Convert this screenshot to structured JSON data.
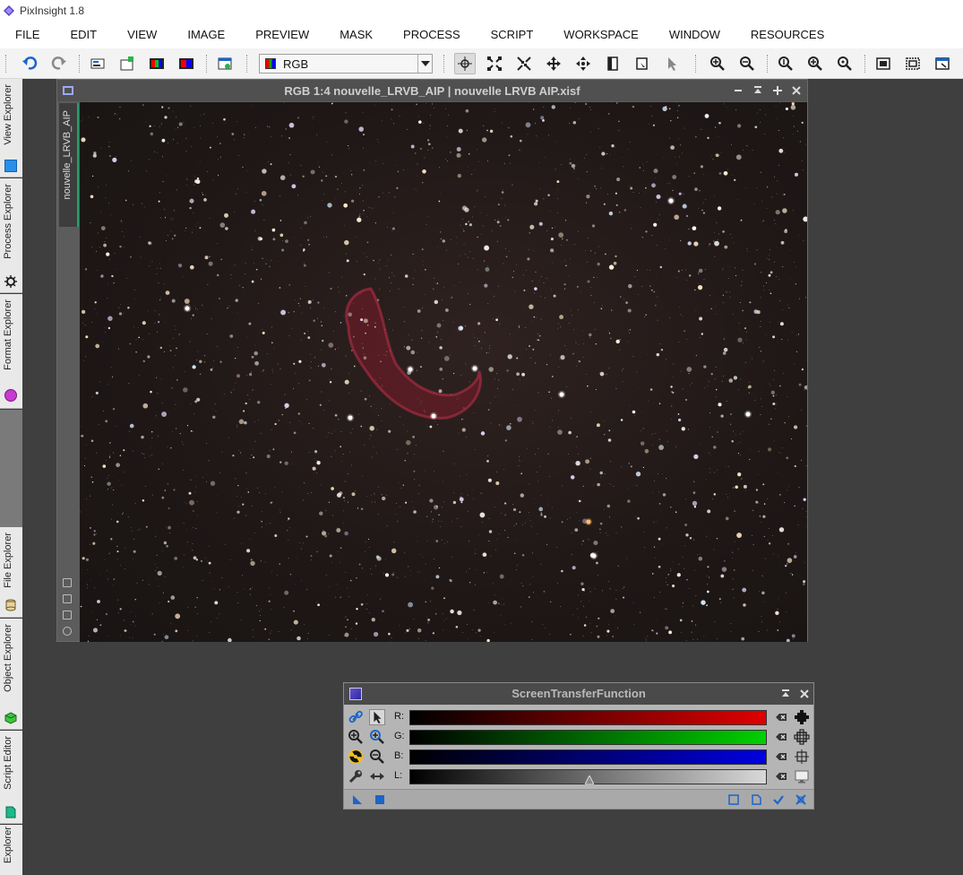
{
  "window": {
    "title": "PixInsight 1.8"
  },
  "menu": [
    "FILE",
    "EDIT",
    "VIEW",
    "IMAGE",
    "PREVIEW",
    "MASK",
    "PROCESS",
    "SCRIPT",
    "WORKSPACE",
    "WINDOW",
    "RESOURCES"
  ],
  "toolbar": {
    "channel_select_value": "RGB"
  },
  "left_dock": {
    "tabs": [
      "View Explorer",
      "Process Explorer",
      "Format Explorer",
      "File Explorer",
      "Object Explorer",
      "Script Editor",
      "Explorer"
    ]
  },
  "image_window": {
    "title": "RGB 1:4 nouvelle_LRVB_AIP | nouvelle LRVB AIP.xisf",
    "view_tab": "nouvelle_LRVB_AIP"
  },
  "stf_panel": {
    "title": "ScreenTransferFunction",
    "channels": [
      {
        "label": "R:",
        "color": "#e00000"
      },
      {
        "label": "G:",
        "color": "#00d000"
      },
      {
        "label": "B:",
        "color": "#0000e0"
      },
      {
        "label": "L:",
        "color": "#d8d8d8"
      }
    ],
    "luminance_midtone_marker": 0.5
  },
  "colors": {
    "workspace_bg": "#3f3f3f",
    "toolbar_bg": "#f3f3f3",
    "panel_title_bg": "#4a4a4a",
    "view_tab_accent": "#1aa36a"
  }
}
